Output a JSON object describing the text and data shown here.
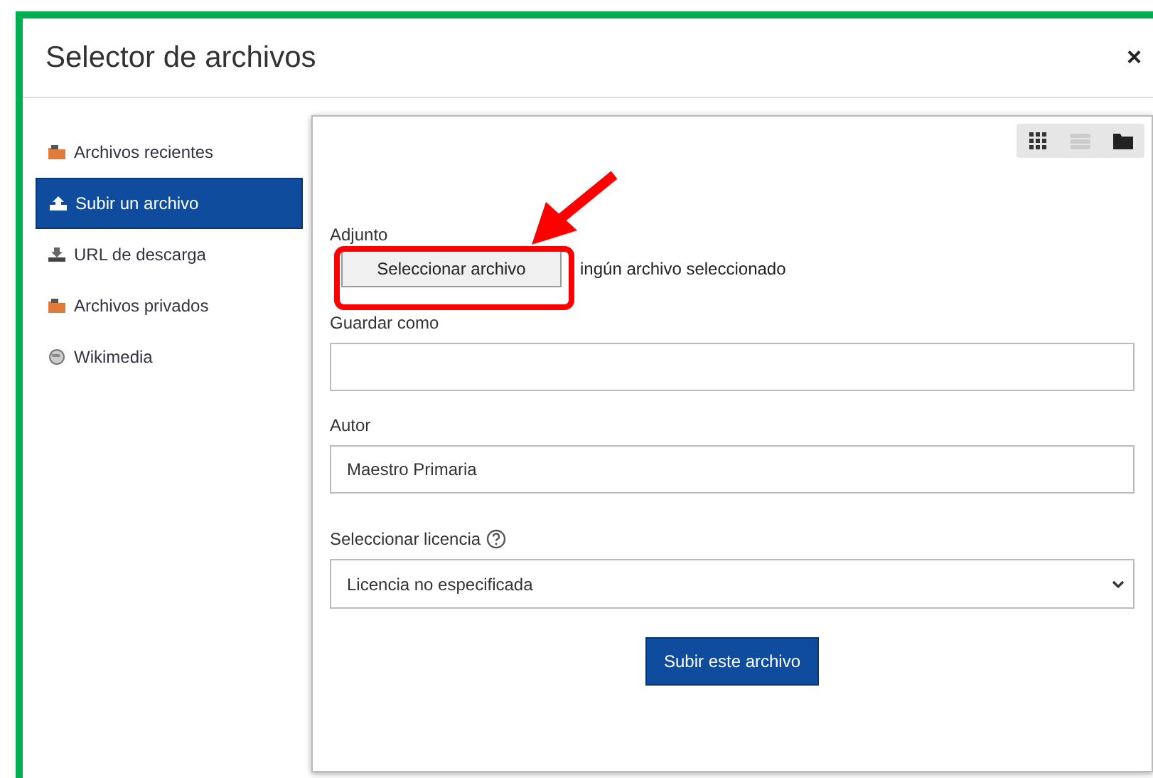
{
  "dialog": {
    "title": "Selector de archivos",
    "close": "×"
  },
  "sidebar": {
    "items": [
      {
        "label": "Archivos recientes",
        "selected": false
      },
      {
        "label": "Subir un archivo",
        "selected": true
      },
      {
        "label": "URL de descarga",
        "selected": false
      },
      {
        "label": "Archivos privados",
        "selected": false
      },
      {
        "label": "Wikimedia",
        "selected": false
      }
    ]
  },
  "form": {
    "attachment_label": "Adjunto",
    "choose_button": "Seleccionar archivo",
    "no_file_text": "ingún archivo seleccionado",
    "save_as": {
      "label": "Guardar como"
    },
    "author": {
      "label": "Autor",
      "value": "Maestro Primaria"
    },
    "license": {
      "label": "Seleccionar licencia",
      "value": "Licencia no especificada"
    },
    "submit": "Subir este archivo"
  },
  "annotations": [
    {
      "kind": "frame",
      "color": "#00b050"
    },
    {
      "kind": "box",
      "color": "#ff0000"
    },
    {
      "kind": "arrow",
      "color": "#ff0000"
    }
  ]
}
